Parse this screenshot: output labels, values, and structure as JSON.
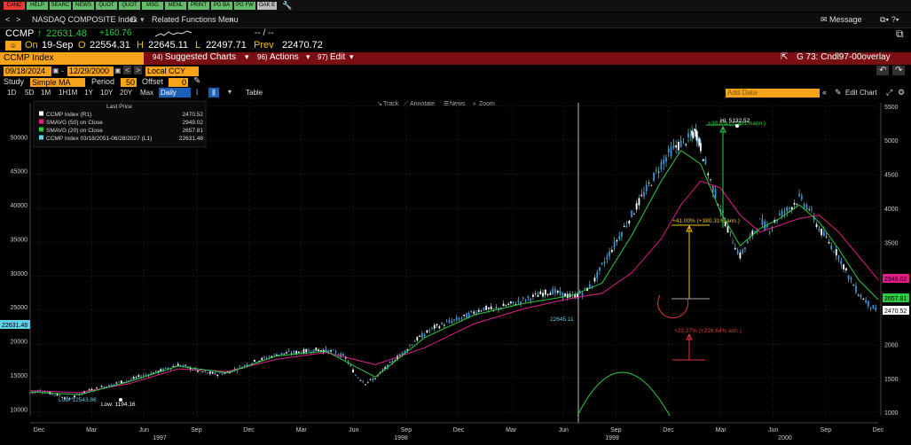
{
  "fkeys": [
    {
      "label": "CANC",
      "color": "#e53935"
    },
    {
      "label": "HELP",
      "color": "#66bb6a"
    },
    {
      "label": "SEARC",
      "color": "#66bb6a"
    },
    {
      "label": "NEWS",
      "color": "#66bb6a"
    },
    {
      "label": "QUOT",
      "color": "#66bb6a"
    },
    {
      "label": "QUOT",
      "color": "#66bb6a"
    },
    {
      "label": "MSG",
      "color": "#66bb6a"
    },
    {
      "label": "MENL",
      "color": "#66bb6a"
    },
    {
      "label": "PRINT",
      "color": "#66bb6a"
    },
    {
      "label": "PG BA",
      "color": "#66bb6a"
    },
    {
      "label": "PG FW",
      "color": "#66bb6a"
    },
    {
      "label": "OAK E",
      "color": "#bbbbbb"
    }
  ],
  "nav": {
    "back": "<",
    "fwd": ">",
    "security": "NASDAQ COMPOSITE Index",
    "yellow_key": "G",
    "related": "Related Functions Menu",
    "message": "Message"
  },
  "quote": {
    "ticker": "CCMP",
    "last": "22631.48",
    "change": "+160.76",
    "dashes": "-- / --",
    "on": "On",
    "date": "19-Sep",
    "o_label": "O",
    "open": "22554.31",
    "h_label": "H",
    "high": "22645.11",
    "l_label": "L",
    "low": "22497.71",
    "prev_label": "Prev",
    "prev": "22470.72"
  },
  "titlebar": {
    "index": "CCMP Index",
    "suggested_num": "94)",
    "suggested": "Suggested Charts",
    "actions_num": "96)",
    "actions": "Actions",
    "edit_num": "97)",
    "edit": "Edit",
    "chart_name": "G 73: Cndl97-00overlay"
  },
  "dates": {
    "start": "09/18/2024",
    "end": "12/29/2000",
    "currency": "Local CCY"
  },
  "study": {
    "label": "Study",
    "type": "Simple MA",
    "period_label": "Period",
    "period": "50",
    "offset_label": "Offset",
    "offset": "0"
  },
  "tabs": [
    "1D",
    "5D",
    "1M",
    "1H1M",
    "1Y",
    "10Y",
    "20Y",
    "Max"
  ],
  "tab_selected": "Daily",
  "table_label": "Table",
  "add_data": "Add Data",
  "edit_chart": "Edit Chart",
  "tools": [
    "Track",
    "Annotate",
    "News",
    "Zoom"
  ],
  "legend": {
    "header": "Last Price",
    "items": [
      {
        "name": "CCMP Index  (R1)",
        "value": "2470.52",
        "color": "#ffffff"
      },
      {
        "name": "SMAVG (50)  on Close",
        "value": "2949.02",
        "color": "#e0208a"
      },
      {
        "name": "SMAVG (20)  on Close",
        "value": "2657.81",
        "color": "#2ecc40"
      },
      {
        "name": "CCMP Index 03/18/2051-06/28/2027  (L1)",
        "value": "22631.48",
        "color": "#5fd0e8"
      }
    ]
  },
  "chart_data": {
    "type": "line",
    "x_labels": [
      "Dec",
      "Mar",
      "Jun",
      "Sep",
      "Dec",
      "Mar",
      "Jun",
      "Sep",
      "Dec",
      "Mar",
      "Jun",
      "Sep",
      "Dec",
      "Mar",
      "Jun",
      "Sep",
      "Dec"
    ],
    "years": [
      "1997",
      "1998",
      "1999",
      "2000"
    ],
    "left_axis": [
      10000,
      15000,
      20000,
      25000,
      30000,
      35000,
      40000,
      45000,
      50000
    ],
    "right_axis": [
      1000,
      1500,
      2000,
      2500,
      3000,
      3500,
      4000,
      4500,
      5000,
      5500
    ],
    "right_ylim": [
      950,
      5550
    ],
    "left_ylim": [
      9000,
      55000
    ],
    "series": [
      {
        "name": "CCMP Index (R1)",
        "points": [
          [
            0,
            1290
          ],
          [
            4,
            1320
          ],
          [
            8,
            1280
          ],
          [
            12,
            1250
          ],
          [
            16,
            1194
          ],
          [
            20,
            1270
          ],
          [
            24,
            1320
          ],
          [
            28,
            1360
          ],
          [
            32,
            1390
          ],
          [
            36,
            1440
          ],
          [
            40,
            1470
          ],
          [
            44,
            1520
          ],
          [
            48,
            1560
          ],
          [
            52,
            1600
          ],
          [
            56,
            1650
          ],
          [
            60,
            1700
          ],
          [
            64,
            1660
          ],
          [
            68,
            1610
          ],
          [
            72,
            1580
          ],
          [
            76,
            1560
          ],
          [
            80,
            1590
          ],
          [
            84,
            1640
          ],
          [
            88,
            1700
          ],
          [
            92,
            1760
          ],
          [
            96,
            1800
          ],
          [
            100,
            1850
          ],
          [
            104,
            1870
          ],
          [
            108,
            1880
          ],
          [
            112,
            1900
          ],
          [
            116,
            1920
          ],
          [
            120,
            1910
          ],
          [
            124,
            1880
          ],
          [
            128,
            1800
          ],
          [
            132,
            1550
          ],
          [
            136,
            1430
          ],
          [
            140,
            1500
          ],
          [
            144,
            1640
          ],
          [
            148,
            1780
          ],
          [
            152,
            1900
          ],
          [
            156,
            2050
          ],
          [
            160,
            2150
          ],
          [
            164,
            2250
          ],
          [
            168,
            2300
          ],
          [
            172,
            2350
          ],
          [
            176,
            2400
          ],
          [
            180,
            2470
          ],
          [
            184,
            2530
          ],
          [
            188,
            2510
          ],
          [
            192,
            2560
          ],
          [
            196,
            2600
          ],
          [
            200,
            2650
          ],
          [
            204,
            2700
          ],
          [
            208,
            2750
          ],
          [
            212,
            2780
          ],
          [
            216,
            2730
          ],
          [
            220,
            2700
          ],
          [
            224,
            2760
          ],
          [
            228,
            2880
          ],
          [
            232,
            3150
          ],
          [
            236,
            3400
          ],
          [
            240,
            3650
          ],
          [
            244,
            3900
          ],
          [
            248,
            4150
          ],
          [
            252,
            4400
          ],
          [
            256,
            4650
          ],
          [
            260,
            4850
          ],
          [
            264,
            4950
          ],
          [
            268,
            5040
          ],
          [
            270,
            5132
          ],
          [
            272,
            4900
          ],
          [
            276,
            4400
          ],
          [
            280,
            4000
          ],
          [
            284,
            3600
          ],
          [
            288,
            3300
          ],
          [
            292,
            3550
          ],
          [
            296,
            3800
          ],
          [
            300,
            3700
          ],
          [
            304,
            3900
          ],
          [
            308,
            4000
          ],
          [
            312,
            4150
          ],
          [
            316,
            4000
          ],
          [
            320,
            3700
          ],
          [
            324,
            3500
          ],
          [
            328,
            3300
          ],
          [
            332,
            3000
          ],
          [
            336,
            2750
          ],
          [
            340,
            2600
          ],
          [
            344,
            2470
          ]
        ],
        "color": "#5fd0e8"
      },
      {
        "name": "SMAVG (50) on Close",
        "points": [
          [
            0,
            1320
          ],
          [
            20,
            1290
          ],
          [
            40,
            1420
          ],
          [
            60,
            1640
          ],
          [
            80,
            1600
          ],
          [
            100,
            1780
          ],
          [
            120,
            1880
          ],
          [
            140,
            1700
          ],
          [
            160,
            1950
          ],
          [
            180,
            2300
          ],
          [
            200,
            2520
          ],
          [
            220,
            2680
          ],
          [
            232,
            2750
          ],
          [
            244,
            3050
          ],
          [
            256,
            3550
          ],
          [
            264,
            4050
          ],
          [
            272,
            4400
          ],
          [
            280,
            4300
          ],
          [
            288,
            3900
          ],
          [
            296,
            3650
          ],
          [
            304,
            3750
          ],
          [
            312,
            3850
          ],
          [
            320,
            3900
          ],
          [
            328,
            3650
          ],
          [
            336,
            3300
          ],
          [
            344,
            2949
          ]
        ],
        "color": "#e0208a"
      },
      {
        "name": "SMAVG (20) on Close",
        "points": [
          [
            0,
            1300
          ],
          [
            20,
            1260
          ],
          [
            40,
            1450
          ],
          [
            60,
            1680
          ],
          [
            80,
            1580
          ],
          [
            100,
            1830
          ],
          [
            120,
            1900
          ],
          [
            140,
            1520
          ],
          [
            160,
            2100
          ],
          [
            180,
            2430
          ],
          [
            200,
            2600
          ],
          [
            220,
            2720
          ],
          [
            232,
            2900
          ],
          [
            244,
            3600
          ],
          [
            256,
            4400
          ],
          [
            264,
            4850
          ],
          [
            272,
            4650
          ],
          [
            280,
            3950
          ],
          [
            288,
            3450
          ],
          [
            296,
            3700
          ],
          [
            304,
            3850
          ],
          [
            312,
            4050
          ],
          [
            320,
            3800
          ],
          [
            328,
            3400
          ],
          [
            336,
            2950
          ],
          [
            344,
            2657
          ]
        ],
        "color": "#2ecc40"
      }
    ],
    "annotations": [
      {
        "text": "Low: 12543.86",
        "color": "#5fd0e8"
      },
      {
        "text": "Low: 1194.16",
        "color": "#ffffff"
      },
      {
        "text": "+41.00% (+380.31% ann.)",
        "color": "#f1c40f"
      },
      {
        "text": "+38.8%  (+2461%ann.)",
        "color": "#2ecc40"
      },
      {
        "text": "Hi: 5132.52",
        "color": "#ffffff"
      },
      {
        "text": "+22.27% (+226.64% ann.)",
        "color": "#e53935"
      },
      {
        "text": "22645.11",
        "color": "#5fd0e8"
      }
    ],
    "axis_tags": [
      {
        "axis": "right",
        "value": "2949.02",
        "color": "#e0208a"
      },
      {
        "axis": "right",
        "value": "2657.81",
        "color": "#2ecc40"
      },
      {
        "axis": "right",
        "value": "2470.52",
        "color": "#ffffff"
      },
      {
        "axis": "left",
        "value": "22631.48",
        "color": "#5fd0e8"
      }
    ]
  }
}
